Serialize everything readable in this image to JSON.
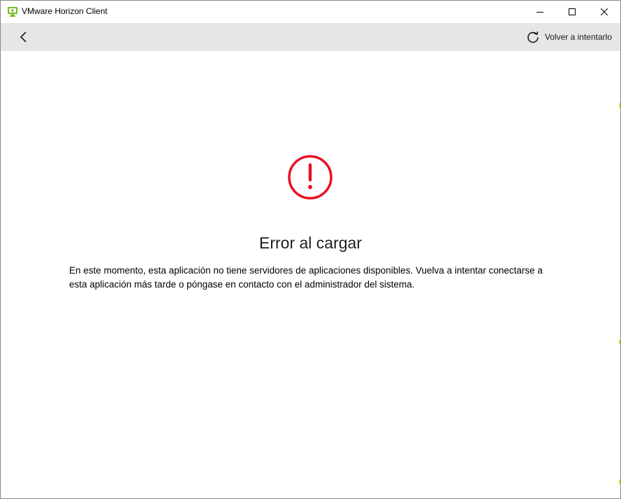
{
  "window": {
    "title": "VMware Horizon Client",
    "accent_color": "#78be20"
  },
  "toolbar": {
    "back_icon": "chevron-left-icon",
    "retry_icon": "refresh-icon",
    "retry_label": "Volver a intentarlo"
  },
  "error": {
    "icon": "error-exclamation-icon",
    "icon_color": "#e81123",
    "title": "Error al cargar",
    "message": "En este momento, esta aplicación no tiene servidores de aplicaciones disponibles. Vuelva a intentar conectarse a esta aplicación más tarde o póngase en contacto con el administrador del sistema."
  }
}
